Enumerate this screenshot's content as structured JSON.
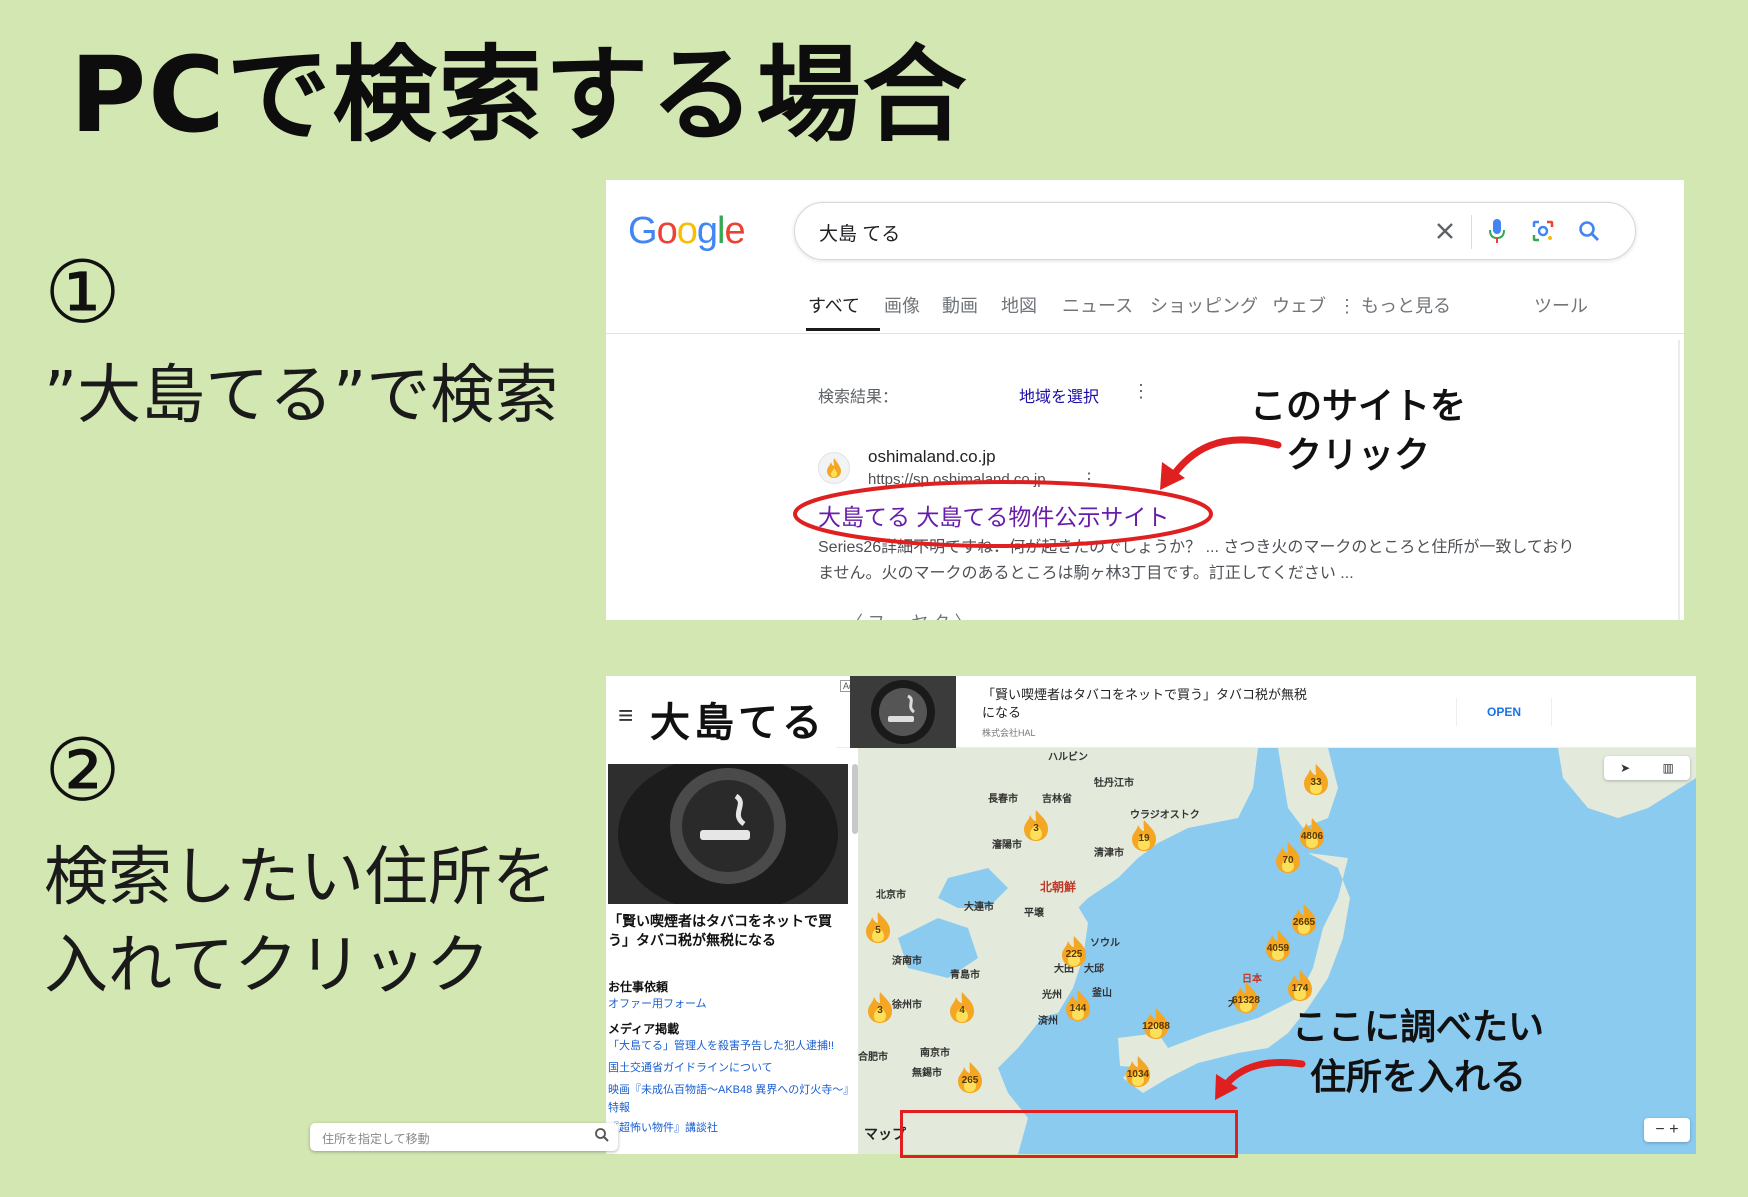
{
  "title": "PCで検索する場合",
  "step1": {
    "num": "①",
    "text": "”大島てる”で検索"
  },
  "step2": {
    "num": "②",
    "text": "検索したい住所を\n入れてクリック"
  },
  "google": {
    "logo": [
      "G",
      "o",
      "o",
      "g",
      "l",
      "e"
    ],
    "query": "大島 てる",
    "tabs": [
      "すべて",
      "画像",
      "動画",
      "地図",
      "ニュース",
      "ショッピング",
      "ウェブ",
      "もっと見る",
      "ツール"
    ],
    "results_meta": "検索結果：",
    "region": "地域を選択",
    "result": {
      "domain": "oshimaland.co.jp",
      "url": "https://sp.oshimaland.co.jp",
      "title": "大島てる 大島てる物件公示サイト",
      "snippet": "Series26詳細不明ですね．何が起きたのでしょうか？ ... さつき火のマークのところと住所が一致しておりません。火のマークのあるところは駒ヶ林3丁目です。訂正してください ...",
      "cut_text": "〈 フ … ヤ ク 〉"
    },
    "annotation": "このサイトを\nクリック"
  },
  "oshima": {
    "logo": "大島てる",
    "ad": {
      "badge": "Ad",
      "text": "「賢い喫煙者はタバコをネットで買う」タバコ税が無税になる",
      "advertiser": "株式会社HAL",
      "open": "OPEN"
    },
    "sidebar": {
      "title": "「賢い喫煙者はタバコをネットで買う」タバコ税が無税になる",
      "h1": "お仕事依頼",
      "link1": "オファー用フォーム",
      "h2": "メディア掲載",
      "links": [
        "「大島てる」管理人を殺害予告した犯人逮捕!!",
        "国土交通省ガイドラインについて",
        "映画『未成仏百物語～AKB48 異界への灯火寺～』特報",
        "『超怖い物件』講談社"
      ]
    },
    "map": {
      "cities": [
        "ハルビン",
        "牡丹江市",
        "長春市",
        "吉林省",
        "ウラジオストク",
        "瀋陽市",
        "清津市",
        "北京市",
        "大連市",
        "平壌",
        "ソウル",
        "大田",
        "大邱",
        "光州",
        "釜山",
        "済南市",
        "青島市",
        "徐州市",
        "南京市",
        "無錫市",
        "合肥市",
        "日本",
        "大阪市",
        "済州"
      ],
      "korea_label": "北朝鮮",
      "clusters": [
        "33",
        "4806",
        "70",
        "19",
        "3",
        "2665",
        "4059",
        "174",
        "225",
        "61328",
        "144",
        "12088",
        "4",
        "5",
        "3",
        "1034",
        "265"
      ],
      "map_label": "マップ",
      "search_placeholder": "住所を指定して移動",
      "zoom": "− +"
    },
    "annotation": "ここに調べたい\n住所を入れる"
  },
  "colors": {
    "background": "#d3e7b2",
    "annotation_red": "#e02020",
    "visited_link": "#681da8",
    "map_water": "#8bcbf0",
    "map_land": "#e8eee0"
  }
}
